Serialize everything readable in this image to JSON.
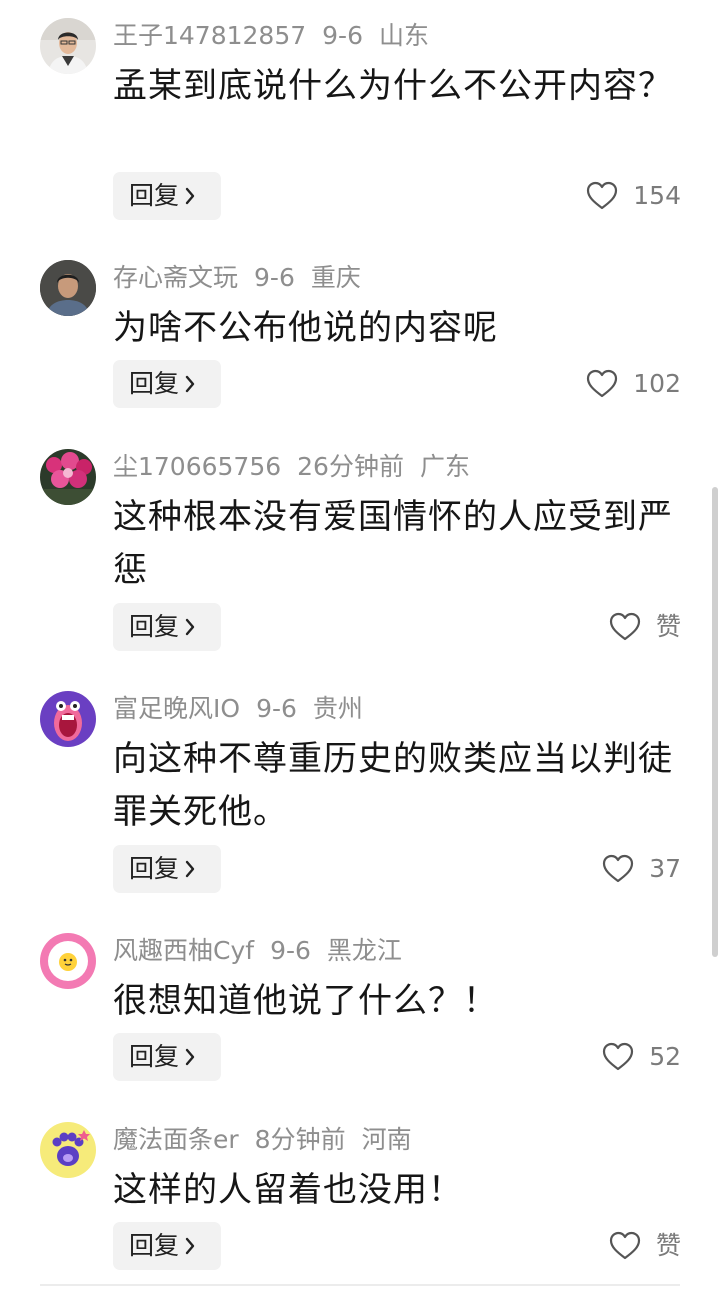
{
  "comments": [
    {
      "avatar": "avatar-man-in-suit",
      "username": "王子147812857",
      "time": "9-6",
      "location": "山东",
      "text": "孟某到底说什么为什么不公开内容？",
      "reply_label": "回复",
      "likes": "154"
    },
    {
      "avatar": "avatar-man-portrait",
      "username": "存心斋文玩",
      "time": "9-6",
      "location": "重庆",
      "text": "为啥不公布他说的内容呢",
      "reply_label": "回复",
      "likes": "102"
    },
    {
      "avatar": "avatar-red-flowers",
      "username": "尘170665756",
      "time": "26分钟前",
      "location": "广东",
      "text": "这种根本没有爱国情怀的人应受到严惩",
      "reply_label": "回复",
      "likes": "赞"
    },
    {
      "avatar": "avatar-cartoon-mouth",
      "username": "富足晚风IO",
      "time": "9-6",
      "location": "贵州",
      "text": "向这种不尊重历史的败类应当以判徒罪关死他。",
      "reply_label": "回复",
      "likes": "37"
    },
    {
      "avatar": "avatar-egg",
      "username": "风趣西柚Cyf",
      "time": "9-6",
      "location": "黑龙江",
      "text": "很想知道他说了什么？！",
      "reply_label": "回复",
      "likes": "52"
    },
    {
      "avatar": "avatar-paw",
      "username": "魔法面条er",
      "time": "8分钟前",
      "location": "河南",
      "text": "这样的人留着也没用！",
      "reply_label": "回复",
      "likes": "赞"
    }
  ],
  "colors": {
    "meta_text": "#8e8e8e",
    "body_text": "#161616",
    "reply_bg": "#f2f2f2",
    "heart_stroke": "#555555"
  }
}
